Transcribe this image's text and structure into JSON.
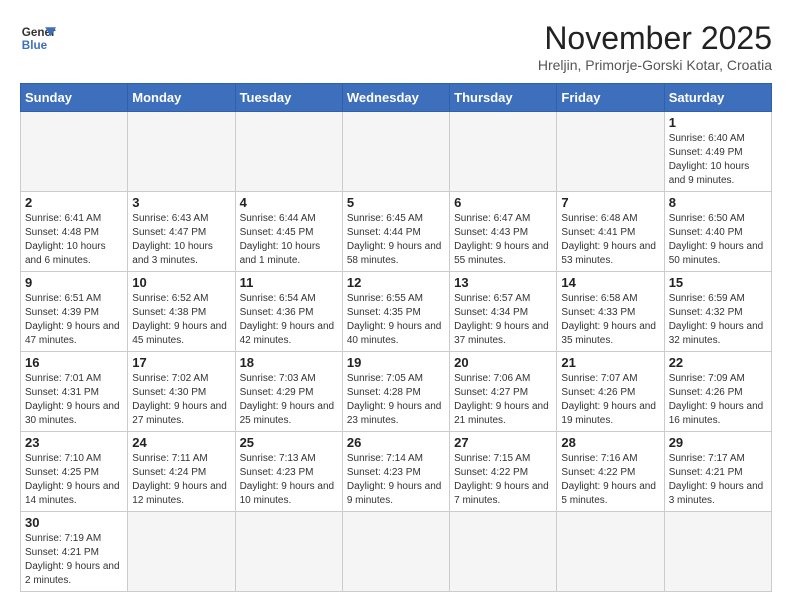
{
  "logo": {
    "line1": "General",
    "line2": "Blue"
  },
  "header": {
    "month": "November 2025",
    "location": "Hreljin, Primorje-Gorski Kotar, Croatia"
  },
  "weekdays": [
    "Sunday",
    "Monday",
    "Tuesday",
    "Wednesday",
    "Thursday",
    "Friday",
    "Saturday"
  ],
  "weeks": [
    [
      {
        "day": "",
        "info": ""
      },
      {
        "day": "",
        "info": ""
      },
      {
        "day": "",
        "info": ""
      },
      {
        "day": "",
        "info": ""
      },
      {
        "day": "",
        "info": ""
      },
      {
        "day": "",
        "info": ""
      },
      {
        "day": "1",
        "info": "Sunrise: 6:40 AM\nSunset: 4:49 PM\nDaylight: 10 hours and 9 minutes."
      }
    ],
    [
      {
        "day": "2",
        "info": "Sunrise: 6:41 AM\nSunset: 4:48 PM\nDaylight: 10 hours and 6 minutes."
      },
      {
        "day": "3",
        "info": "Sunrise: 6:43 AM\nSunset: 4:47 PM\nDaylight: 10 hours and 3 minutes."
      },
      {
        "day": "4",
        "info": "Sunrise: 6:44 AM\nSunset: 4:45 PM\nDaylight: 10 hours and 1 minute."
      },
      {
        "day": "5",
        "info": "Sunrise: 6:45 AM\nSunset: 4:44 PM\nDaylight: 9 hours and 58 minutes."
      },
      {
        "day": "6",
        "info": "Sunrise: 6:47 AM\nSunset: 4:43 PM\nDaylight: 9 hours and 55 minutes."
      },
      {
        "day": "7",
        "info": "Sunrise: 6:48 AM\nSunset: 4:41 PM\nDaylight: 9 hours and 53 minutes."
      },
      {
        "day": "8",
        "info": "Sunrise: 6:50 AM\nSunset: 4:40 PM\nDaylight: 9 hours and 50 minutes."
      }
    ],
    [
      {
        "day": "9",
        "info": "Sunrise: 6:51 AM\nSunset: 4:39 PM\nDaylight: 9 hours and 47 minutes."
      },
      {
        "day": "10",
        "info": "Sunrise: 6:52 AM\nSunset: 4:38 PM\nDaylight: 9 hours and 45 minutes."
      },
      {
        "day": "11",
        "info": "Sunrise: 6:54 AM\nSunset: 4:36 PM\nDaylight: 9 hours and 42 minutes."
      },
      {
        "day": "12",
        "info": "Sunrise: 6:55 AM\nSunset: 4:35 PM\nDaylight: 9 hours and 40 minutes."
      },
      {
        "day": "13",
        "info": "Sunrise: 6:57 AM\nSunset: 4:34 PM\nDaylight: 9 hours and 37 minutes."
      },
      {
        "day": "14",
        "info": "Sunrise: 6:58 AM\nSunset: 4:33 PM\nDaylight: 9 hours and 35 minutes."
      },
      {
        "day": "15",
        "info": "Sunrise: 6:59 AM\nSunset: 4:32 PM\nDaylight: 9 hours and 32 minutes."
      }
    ],
    [
      {
        "day": "16",
        "info": "Sunrise: 7:01 AM\nSunset: 4:31 PM\nDaylight: 9 hours and 30 minutes."
      },
      {
        "day": "17",
        "info": "Sunrise: 7:02 AM\nSunset: 4:30 PM\nDaylight: 9 hours and 27 minutes."
      },
      {
        "day": "18",
        "info": "Sunrise: 7:03 AM\nSunset: 4:29 PM\nDaylight: 9 hours and 25 minutes."
      },
      {
        "day": "19",
        "info": "Sunrise: 7:05 AM\nSunset: 4:28 PM\nDaylight: 9 hours and 23 minutes."
      },
      {
        "day": "20",
        "info": "Sunrise: 7:06 AM\nSunset: 4:27 PM\nDaylight: 9 hours and 21 minutes."
      },
      {
        "day": "21",
        "info": "Sunrise: 7:07 AM\nSunset: 4:26 PM\nDaylight: 9 hours and 19 minutes."
      },
      {
        "day": "22",
        "info": "Sunrise: 7:09 AM\nSunset: 4:26 PM\nDaylight: 9 hours and 16 minutes."
      }
    ],
    [
      {
        "day": "23",
        "info": "Sunrise: 7:10 AM\nSunset: 4:25 PM\nDaylight: 9 hours and 14 minutes."
      },
      {
        "day": "24",
        "info": "Sunrise: 7:11 AM\nSunset: 4:24 PM\nDaylight: 9 hours and 12 minutes."
      },
      {
        "day": "25",
        "info": "Sunrise: 7:13 AM\nSunset: 4:23 PM\nDaylight: 9 hours and 10 minutes."
      },
      {
        "day": "26",
        "info": "Sunrise: 7:14 AM\nSunset: 4:23 PM\nDaylight: 9 hours and 9 minutes."
      },
      {
        "day": "27",
        "info": "Sunrise: 7:15 AM\nSunset: 4:22 PM\nDaylight: 9 hours and 7 minutes."
      },
      {
        "day": "28",
        "info": "Sunrise: 7:16 AM\nSunset: 4:22 PM\nDaylight: 9 hours and 5 minutes."
      },
      {
        "day": "29",
        "info": "Sunrise: 7:17 AM\nSunset: 4:21 PM\nDaylight: 9 hours and 3 minutes."
      }
    ],
    [
      {
        "day": "30",
        "info": "Sunrise: 7:19 AM\nSunset: 4:21 PM\nDaylight: 9 hours and 2 minutes."
      },
      {
        "day": "",
        "info": ""
      },
      {
        "day": "",
        "info": ""
      },
      {
        "day": "",
        "info": ""
      },
      {
        "day": "",
        "info": ""
      },
      {
        "day": "",
        "info": ""
      },
      {
        "day": "",
        "info": ""
      }
    ]
  ]
}
